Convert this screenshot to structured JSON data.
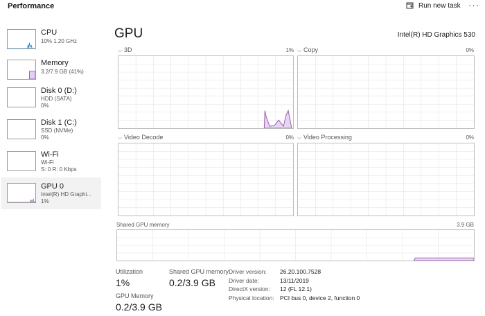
{
  "app": {
    "title": "Performance"
  },
  "toolbar": {
    "run_new_task": "Run new task",
    "more": "···"
  },
  "sidebar": {
    "items": [
      {
        "name": "CPU",
        "line1": "10% 1.20 GHz",
        "line2": ""
      },
      {
        "name": "Memory",
        "line1": "3.2/7.9 GB (41%)",
        "line2": ""
      },
      {
        "name": "Disk 0 (D:)",
        "line1": "HDD (SATA)",
        "line2": "0%"
      },
      {
        "name": "Disk 1 (C:)",
        "line1": "SSD (NVMe)",
        "line2": "0%"
      },
      {
        "name": "Wi-Fi",
        "line1": "Wi-Fi",
        "line2": "S: 0 R: 0 Kbps"
      },
      {
        "name": "GPU 0",
        "line1": "Intel(R) HD Graphi...",
        "line2": "1%"
      }
    ]
  },
  "main": {
    "title": "GPU",
    "adapter": "Intel(R) HD Graphics 530"
  },
  "engines": [
    {
      "label": "3D",
      "percent": "1%"
    },
    {
      "label": "Copy",
      "percent": "0%"
    },
    {
      "label": "Video Decode",
      "percent": "0%"
    },
    {
      "label": "Video Processing",
      "percent": "0%"
    }
  ],
  "shared_memory_graph": {
    "label": "Shared GPU memory",
    "max": "3.9 GB"
  },
  "stats": {
    "utilization_label": "Utilization",
    "utilization_value": "1%",
    "gpu_memory_label": "GPU Memory",
    "gpu_memory_value": "0.2/3.9 GB",
    "shared_label": "Shared GPU memory",
    "shared_value": "0.2/3.9 GB"
  },
  "info": {
    "driver_version_label": "Driver version:",
    "driver_version": "26.20.100.7528",
    "driver_date_label": "Driver date:",
    "driver_date": "13/11/2019",
    "directx_label": "DirectX version:",
    "directx": "12 (FL 12.1)",
    "location_label": "Physical location:",
    "location": "PCI bus 0, device 2, function 0"
  },
  "colors": {
    "gpu_line": "#9b59b6",
    "gpu_fill": "#e8d5f0",
    "cpu_line": "#1a7fc4",
    "mem_line": "#8a3fc4",
    "grid": "#e4e4e4",
    "selected_bg": "#f2f2f2"
  }
}
